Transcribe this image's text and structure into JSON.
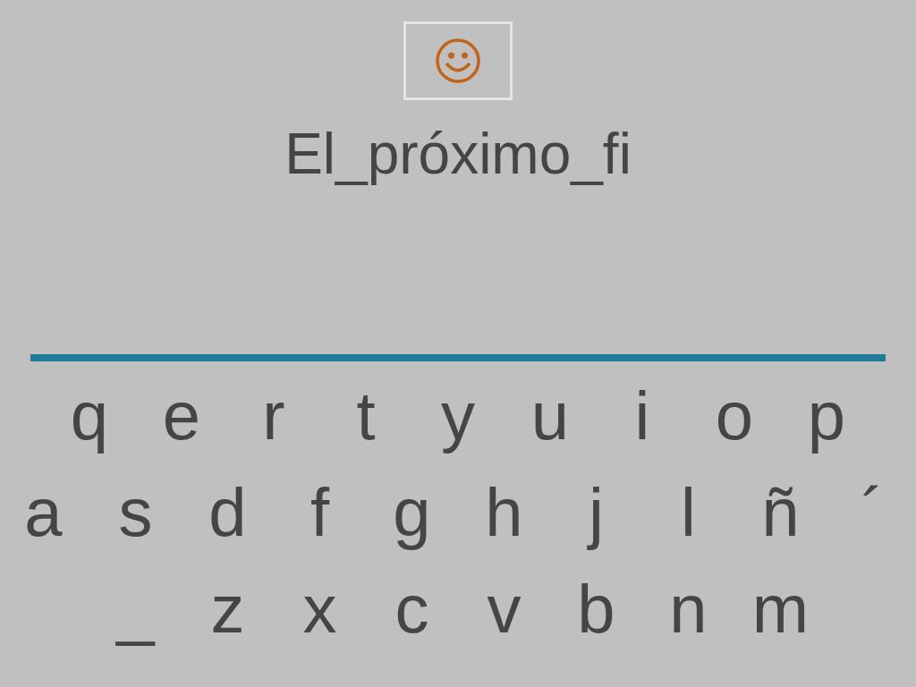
{
  "word": "El_próximo_fi",
  "keyboard": [
    [
      "q",
      "e",
      "r",
      "t",
      "y",
      "u",
      "i",
      "o",
      "p"
    ],
    [
      "a",
      "s",
      "d",
      "f",
      "g",
      "h",
      "j",
      "l",
      "ñ",
      "´"
    ],
    [
      "_",
      "z",
      "x",
      "c",
      "v",
      "b",
      "n",
      "m"
    ]
  ]
}
